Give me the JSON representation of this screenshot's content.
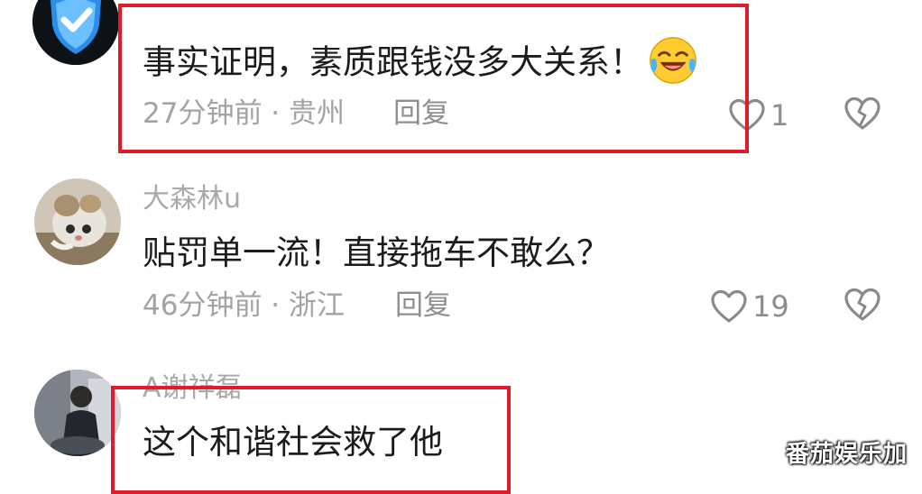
{
  "comments": [
    {
      "username": "",
      "text": "事实证明，素质跟钱没多大关系！",
      "emoji": "laughing-crying-emoji",
      "time_location": "27分钟前 · 贵州",
      "reply": "回复",
      "likes": "1",
      "avatar": "shield-check-icon"
    },
    {
      "username": "大森林u",
      "text": "贴罚单一流！直接拖车不敢么？",
      "time_location": "46分钟前 · 浙江",
      "reply": "回复",
      "likes": "19",
      "avatar": "cat-photo-avatar"
    },
    {
      "username": "A谢祥磊",
      "text": "这个和谐社会救了他",
      "avatar": "person-photo-avatar"
    }
  ],
  "watermark": "番茄娱乐加",
  "colors": {
    "highlight_box": "#e01b2c",
    "meta_text": "#a3a3a3",
    "body_text": "#1c1c1c"
  }
}
